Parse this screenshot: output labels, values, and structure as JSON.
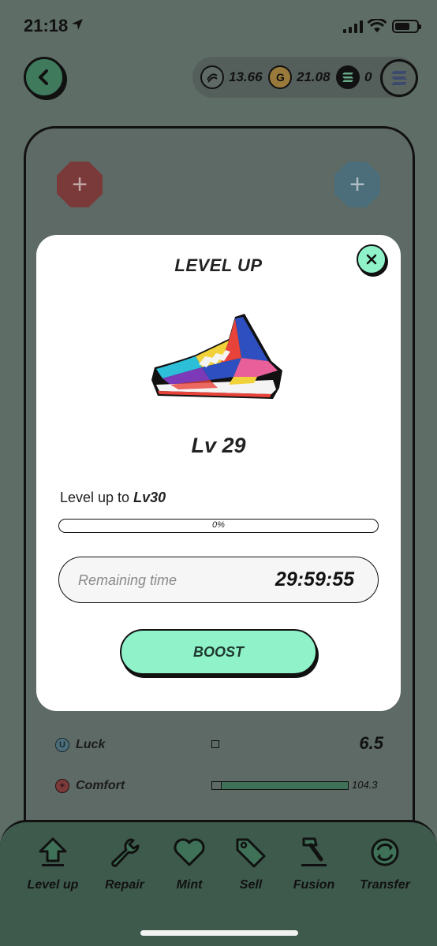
{
  "status_bar": {
    "time": "21:18"
  },
  "header": {
    "balances": [
      {
        "icon": "gst-token-icon",
        "value": "13.66"
      },
      {
        "icon": "gmt-token-icon",
        "value": "21.08"
      },
      {
        "icon": "sol-token-icon",
        "value": "0"
      }
    ]
  },
  "attributes": [
    {
      "name": "Luck",
      "value": "6.5",
      "icon_letter": "U",
      "color": "#4b6e7a"
    },
    {
      "name": "Comfort",
      "value": "104.3",
      "icon_letter": "+",
      "color": "#7b3a3a",
      "fill": 0.93
    }
  ],
  "modal": {
    "title": "LEVEL UP",
    "level": "Lv 29",
    "level_up_prefix": "Level up to",
    "level_up_target": "Lv30",
    "progress_label": "0%",
    "progress_value": 0,
    "remaining_label": "Remaining time",
    "remaining_time": "29:59:55",
    "boost_label": "BOOST"
  },
  "bottom_nav": [
    {
      "label": "Level up",
      "icon": "level-up-arrow-icon"
    },
    {
      "label": "Repair",
      "icon": "wrench-icon"
    },
    {
      "label": "Mint",
      "icon": "heart-icon"
    },
    {
      "label": "Sell",
      "icon": "tag-icon"
    },
    {
      "label": "Fusion",
      "icon": "hammer-icon"
    },
    {
      "label": "Transfer",
      "icon": "transfer-icon"
    }
  ],
  "colors": {
    "accent": "#8ff2c9",
    "overlay": "#5f6d67",
    "nav_bg": "#3e5a4d"
  }
}
